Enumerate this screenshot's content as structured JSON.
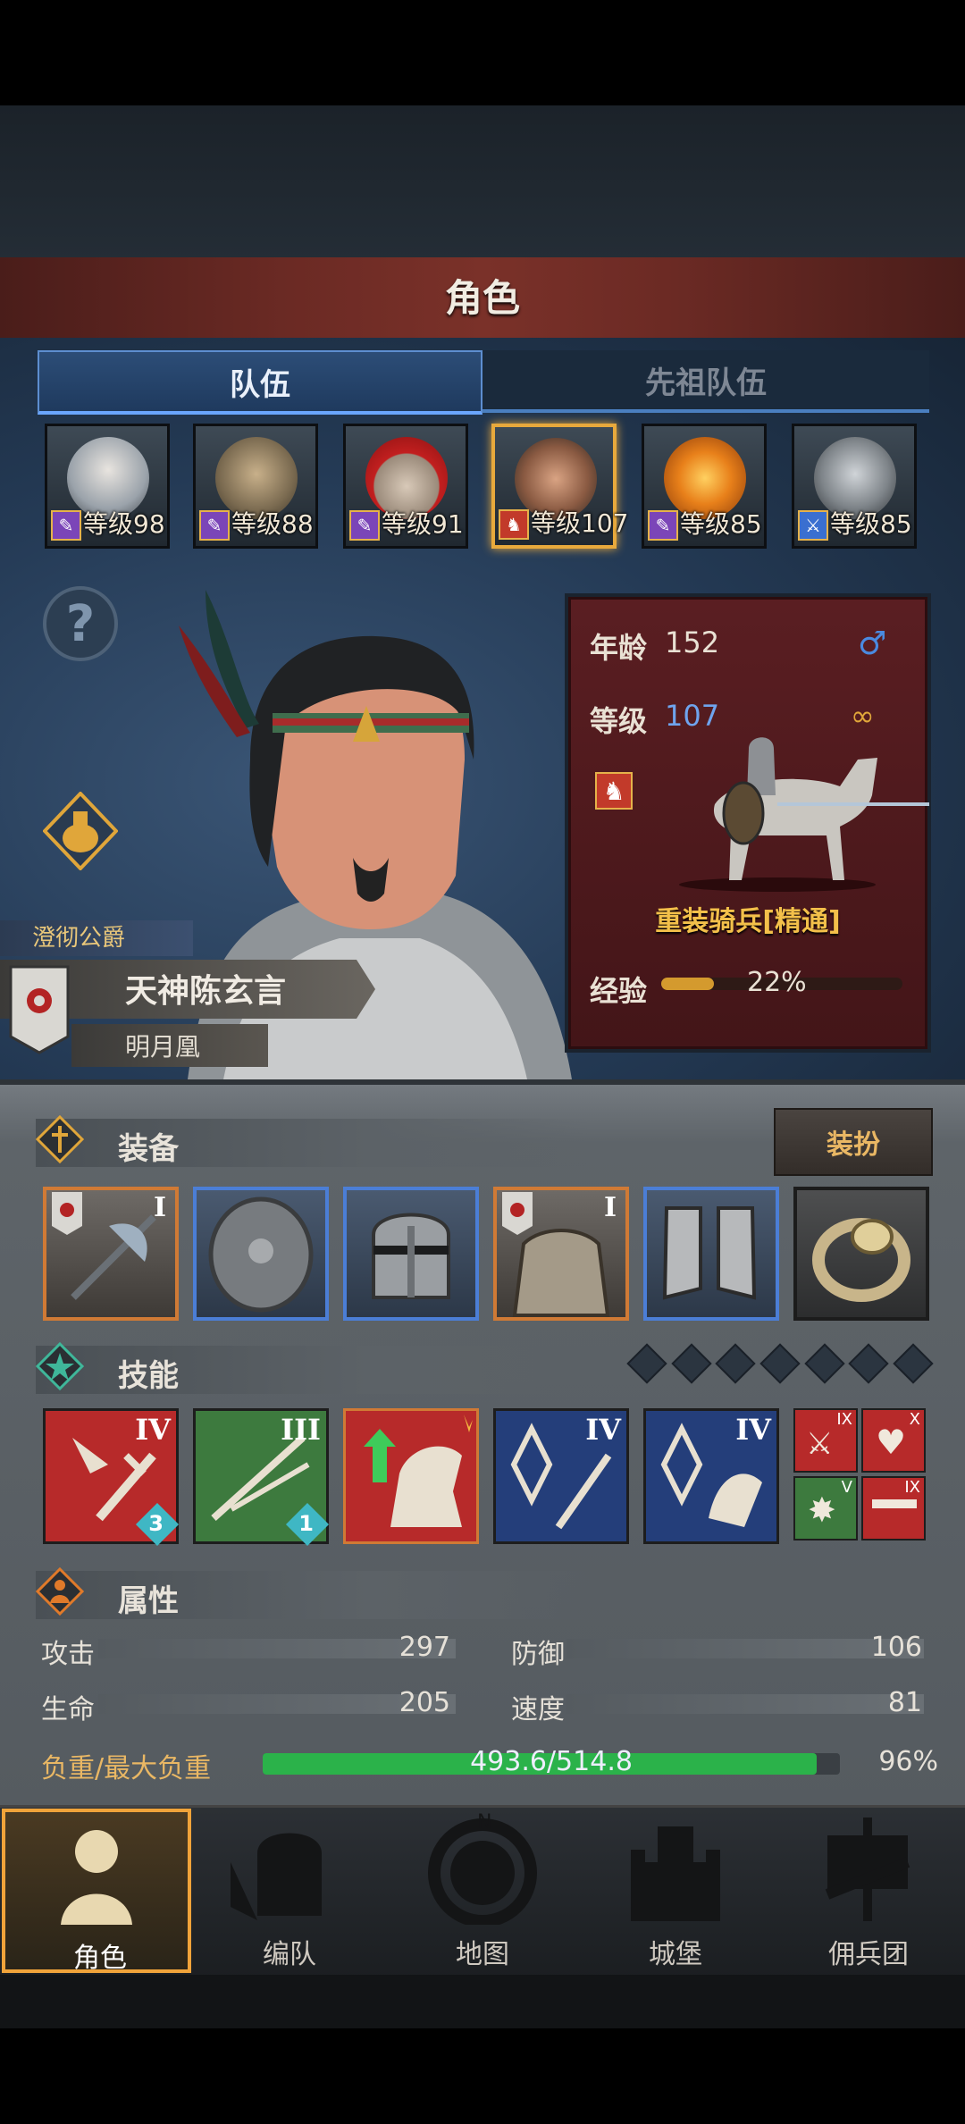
{
  "header": {
    "title": "角色"
  },
  "tabs": [
    {
      "label": "队伍",
      "active": true
    },
    {
      "label": "先祖队伍",
      "active": false
    }
  ],
  "heroes": [
    {
      "level_text": "等级98",
      "class_icon": "staff-icon",
      "class_color": "#7b45b8",
      "selected": false
    },
    {
      "level_text": "等级88",
      "class_icon": "staff-icon",
      "class_color": "#7b45b8",
      "selected": false
    },
    {
      "level_text": "等级91",
      "class_icon": "staff-icon",
      "class_color": "#7b45b8",
      "selected": false
    },
    {
      "level_text": "等级107",
      "class_icon": "cavalry-icon",
      "class_color": "#c23a2a",
      "selected": true
    },
    {
      "level_text": "等级85",
      "class_icon": "staff-icon",
      "class_color": "#7b45b8",
      "selected": false
    },
    {
      "level_text": "等级85",
      "class_icon": "sword-icon",
      "class_color": "#3a6fd0",
      "selected": false
    }
  ],
  "hero": {
    "rank": "澄彻公爵",
    "name": "天神陈玄言",
    "guild": "明月凰",
    "age_label": "年龄",
    "age": "152",
    "level_label": "等级",
    "level": "107",
    "unit_class": "重装骑兵[精通]",
    "exp_label": "经验",
    "exp_percent_text": "22%",
    "exp_fraction": 0.22
  },
  "equipment": {
    "section_title": "装备",
    "dress_button": "装扮",
    "slots": [
      {
        "name": "weapon",
        "tier": "I",
        "border": "#d07a35"
      },
      {
        "name": "shield",
        "tier": "",
        "border": "#4b7ed6"
      },
      {
        "name": "helmet",
        "tier": "",
        "border": "#4b7ed6"
      },
      {
        "name": "armor",
        "tier": "I",
        "border": "#d07a35"
      },
      {
        "name": "boots",
        "tier": "",
        "border": "#4b7ed6"
      },
      {
        "name": "ring",
        "tier": "",
        "border": "#1c1c1c"
      }
    ]
  },
  "skills": {
    "section_title": "技能",
    "items": [
      {
        "tier": "IV",
        "badge": "3",
        "bg": "#b72a2a"
      },
      {
        "tier": "III",
        "badge": "1",
        "bg": "#3d7a3e"
      },
      {
        "tier": "",
        "badge": "",
        "bg": "#b72a2a"
      },
      {
        "tier": "IV",
        "badge": "",
        "bg": "#243e7a"
      },
      {
        "tier": "IV",
        "badge": "",
        "bg": "#243e7a"
      }
    ],
    "mini": [
      {
        "tier": "IX",
        "icon": "sword-icon"
      },
      {
        "tier": "X",
        "icon": "heart-icon"
      },
      {
        "tier": "V",
        "icon": "burst-icon"
      },
      {
        "tier": "IX",
        "icon": "dumbbell-icon"
      }
    ]
  },
  "attributes": {
    "section_title": "属性",
    "attack_label": "攻击",
    "attack": "297",
    "defense_label": "防御",
    "defense": "106",
    "hp_label": "生命",
    "hp": "205",
    "speed_label": "速度",
    "speed": "81",
    "load_label": "负重/最大负重",
    "load": "493.6/514.8",
    "load_percent": "96%",
    "load_fraction": 0.96
  },
  "nav": [
    {
      "label": "角色",
      "active": true
    },
    {
      "label": "编队",
      "active": false
    },
    {
      "label": "地图",
      "active": false
    },
    {
      "label": "城堡",
      "active": false
    },
    {
      "label": "佣兵团",
      "active": false
    }
  ],
  "colors": {
    "accent": "#e8a93c",
    "load_green": "#2bb24a",
    "exp_orange": "#d49a2e"
  }
}
